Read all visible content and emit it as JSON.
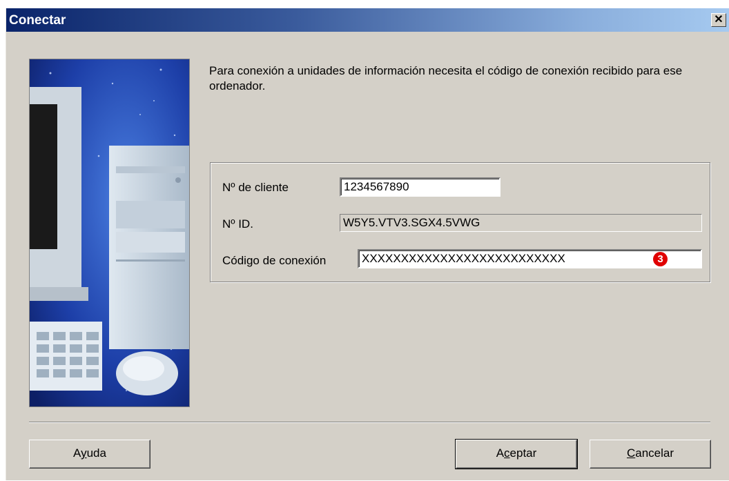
{
  "window": {
    "title": "Conectar",
    "close_glyph": "✕"
  },
  "intro_text": "Para conexión a unidades de información necesita el código de conexión recibido para ese ordenador.",
  "form": {
    "client_label": "Nº de cliente",
    "client_value": "1234567890",
    "id_label": "Nº ID.",
    "id_value": "W5Y5.VTV3.SGX4.5VWG",
    "code_label": "Código de conexión",
    "code_value": "XXXXXXXXXXXXXXXXXXXXXXXXXX",
    "step_badge": "3"
  },
  "buttons": {
    "help": {
      "pre": "A",
      "accel": "y",
      "post": "uda"
    },
    "accept": {
      "pre": "A",
      "accel": "c",
      "post": "eptar"
    },
    "cancel": {
      "pre": "",
      "accel": "C",
      "post": "ancelar"
    }
  },
  "colors": {
    "title_gradient_start": "#0a246a",
    "title_gradient_end": "#a6caf0",
    "badge": "#e00000",
    "dialog_bg": "#d4d0c8"
  },
  "icons": {
    "close": "close-icon",
    "illustration": "computer-illustration"
  }
}
